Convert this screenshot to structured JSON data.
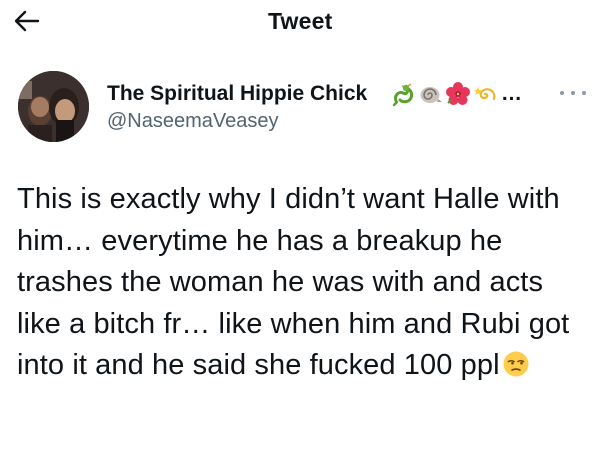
{
  "header": {
    "title": "Tweet",
    "back_icon": "arrow-left-icon"
  },
  "author": {
    "display_name": "The Spiritual Hippie Chick",
    "name_emojis": [
      "dragon-emoji",
      "spiral-shell-emoji",
      "hibiscus-emoji",
      "dizzy-emoji"
    ],
    "name_overflow": "…",
    "handle": "@NaseemaVeasey",
    "more_icon": "more-dots-icon"
  },
  "tweet": {
    "text": "This is exactly why I didn’t want Halle with him… everytime he has a breakup he trashes the woman he was with and acts like a bitch fr… like when him and Rubi got into it and he said she fucked 100 ppl",
    "trailing_emoji": "unamused-face-emoji"
  }
}
